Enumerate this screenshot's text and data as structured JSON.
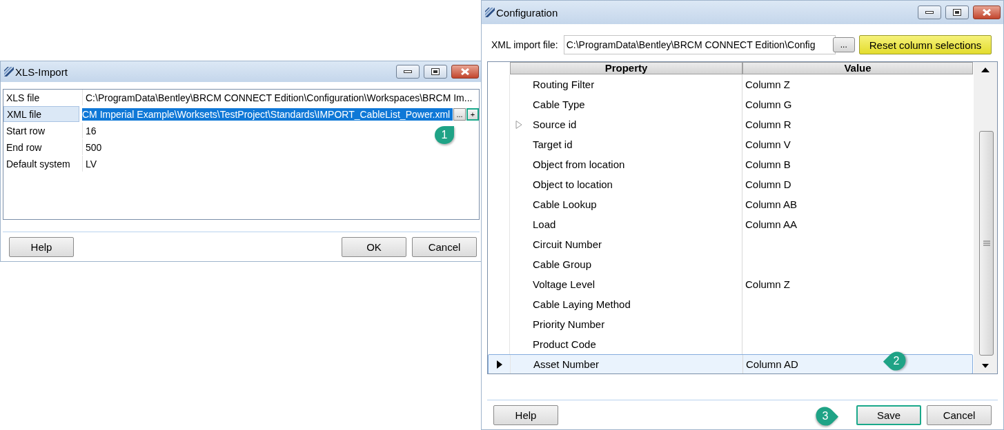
{
  "xls_import": {
    "title": "XLS-Import",
    "properties": [
      {
        "label": "XLS file",
        "value": "C:\\ProgramData\\Bentley\\BRCM CONNECT Edition\\Configuration\\Workspaces\\BRCM Im...",
        "selected": false
      },
      {
        "label": "XML file",
        "value": "CM Imperial Example\\Worksets\\TestProject\\Standards\\IMPORT_CableList_Power.xml",
        "selected": true,
        "buttons": [
          {
            "label": "...",
            "highlighted": false
          },
          {
            "label": "+",
            "highlighted": true
          }
        ]
      },
      {
        "label": "Start row",
        "value": "16",
        "selected": false
      },
      {
        "label": "End row",
        "value": "500",
        "selected": false
      },
      {
        "label": "Default system",
        "value": "LV",
        "selected": false
      }
    ],
    "buttons": [
      {
        "label": "Help",
        "highlighted": false
      },
      {
        "label": "OK",
        "highlighted": false
      },
      {
        "label": "Cancel",
        "highlighted": false
      }
    ]
  },
  "configuration": {
    "title": "Configuration",
    "xml_import_label": "XML import file:",
    "xml_import_value": "C:\\ProgramData\\Bentley\\BRCM CONNECT Edition\\Config",
    "browse_button": "...",
    "reset_button": "Reset column selections",
    "columns": [
      "Property",
      "Value"
    ],
    "rows": [
      {
        "property": "Routing Filter",
        "value": "Column Z",
        "selected": false
      },
      {
        "property": "Cable Type",
        "value": "Column G",
        "selected": false
      },
      {
        "property": "Source id",
        "value": "Column R",
        "selected": false,
        "expanded": false
      },
      {
        "property": "Target id",
        "value": "Column V",
        "selected": false
      },
      {
        "property": "Object from location",
        "value": "Column B",
        "selected": false
      },
      {
        "property": "Object to location",
        "value": "Column D",
        "selected": false
      },
      {
        "property": "Cable Lookup",
        "value": "Column AB",
        "selected": false
      },
      {
        "property": "Load",
        "value": "Column AA",
        "selected": false
      },
      {
        "property": "Circuit Number",
        "selected": false
      },
      {
        "property": "Cable Group",
        "selected": false
      },
      {
        "property": "Voltage Level",
        "value": "Column Z",
        "selected": false
      },
      {
        "property": "Cable Laying Method",
        "selected": false
      },
      {
        "property": "Priority Number",
        "selected": false
      },
      {
        "property": "Product Code",
        "selected": false
      },
      {
        "property": "Asset Number",
        "value": "Column AD",
        "selected": true
      }
    ],
    "buttons": [
      {
        "label": "Help",
        "highlighted": false
      },
      {
        "label": "Save",
        "highlighted": true
      },
      {
        "label": "Cancel",
        "highlighted": false
      }
    ]
  },
  "callouts": [
    {
      "label": "1",
      "kind": "up"
    },
    {
      "label": "2",
      "kind": "left"
    },
    {
      "label": "3",
      "kind": "right"
    }
  ]
}
